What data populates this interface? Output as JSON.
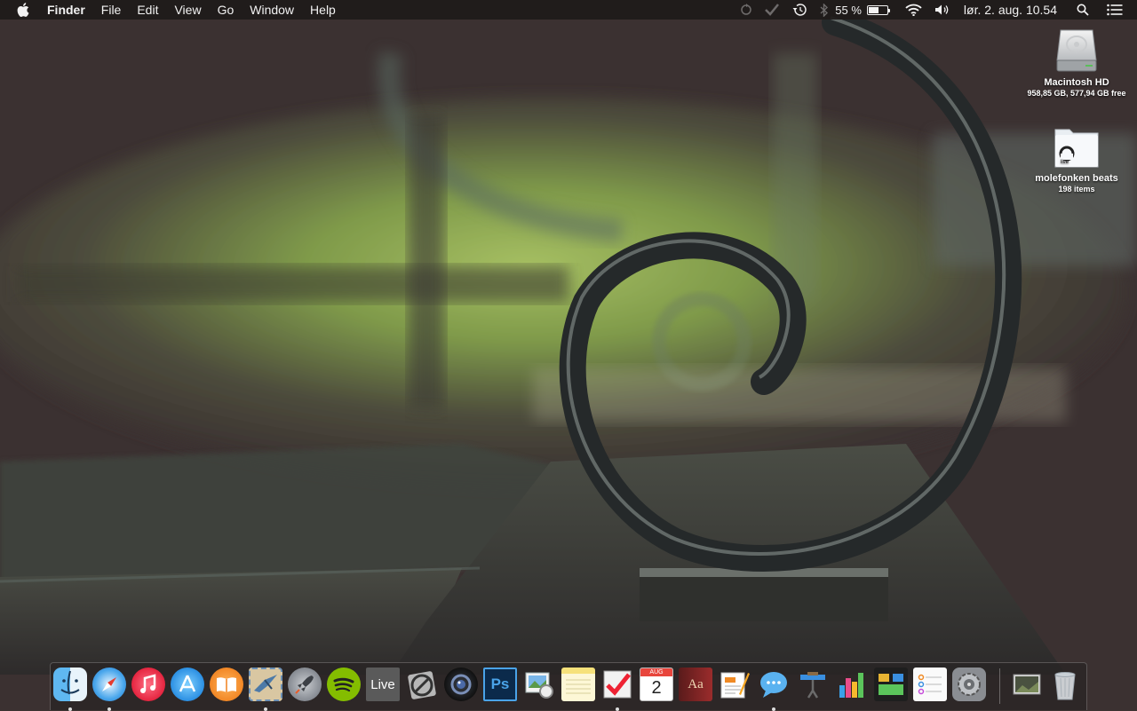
{
  "menubar": {
    "app_name": "Finder",
    "menus": [
      "File",
      "Edit",
      "View",
      "Go",
      "Window",
      "Help"
    ],
    "battery_percent_label": "55 %",
    "battery_level": 0.55,
    "clock": "lør. 2. aug. 10.54",
    "status_icons": [
      "sync-icon",
      "checkmark-icon",
      "time-machine-icon",
      "bluetooth-icon",
      "battery-icon",
      "wifi-icon",
      "volume-icon",
      "spotlight-search-icon",
      "notification-center-icon"
    ]
  },
  "desktop": {
    "items": [
      {
        "name": "Macintosh HD",
        "info": "958,85 GB, 577,94 GB free",
        "icon": "hard-drive-icon"
      },
      {
        "name": "molefonken beats",
        "info": "198 items",
        "icon": "ableton-folder-icon"
      }
    ]
  },
  "dock": {
    "apps": [
      {
        "icon": "finder-icon",
        "running": true
      },
      {
        "icon": "safari-icon",
        "running": true
      },
      {
        "icon": "itunes-icon",
        "running": false
      },
      {
        "icon": "app-store-icon",
        "running": false
      },
      {
        "icon": "ibooks-icon",
        "running": false
      },
      {
        "icon": "mail-icon",
        "running": true
      },
      {
        "icon": "launchpad-icon",
        "running": false
      },
      {
        "icon": "spotify-icon",
        "running": false
      },
      {
        "icon": "ableton-live-icon",
        "label": "Live",
        "running": false
      },
      {
        "icon": "no-entry-icon",
        "running": false
      },
      {
        "icon": "aperture-icon",
        "running": false
      },
      {
        "icon": "photoshop-icon",
        "label": "Ps",
        "running": false
      },
      {
        "icon": "preview-icon",
        "running": false
      },
      {
        "icon": "notes-icon",
        "running": false
      },
      {
        "icon": "wunderlist-icon",
        "running": true
      },
      {
        "icon": "calendar-icon",
        "label": "2",
        "month": "AUG",
        "running": false
      },
      {
        "icon": "dictionary-icon",
        "label": "Aa",
        "running": false
      },
      {
        "icon": "pages-icon",
        "running": false
      },
      {
        "icon": "messages-icon",
        "running": true
      },
      {
        "icon": "keynote-icon",
        "running": false
      },
      {
        "icon": "numbers-icon",
        "running": false
      },
      {
        "icon": "mission-control-icon",
        "running": false
      },
      {
        "icon": "reminders-icon",
        "running": false
      },
      {
        "icon": "system-preferences-icon",
        "running": false
      }
    ],
    "stacks": [
      {
        "icon": "downloads-stack-icon"
      },
      {
        "icon": "trash-icon"
      }
    ]
  }
}
